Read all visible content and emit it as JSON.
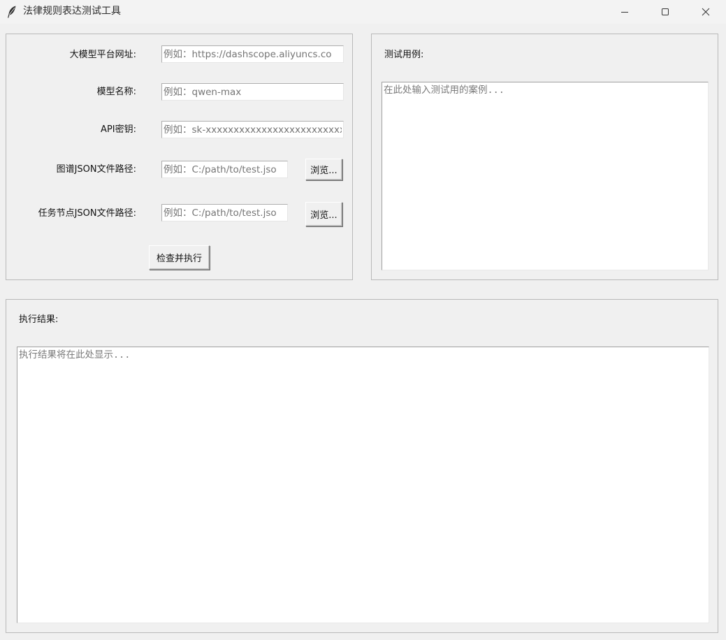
{
  "window": {
    "title": "法律规则表达测试工具",
    "icon": "feather-icon",
    "controls": {
      "minimize": "minimize-icon",
      "maximize": "maximize-icon",
      "close": "close-icon"
    }
  },
  "config": {
    "platform_url": {
      "label": "大模型平台网址:",
      "placeholder": "例如：https://dashscope.aliyuncs.co"
    },
    "model_name": {
      "label": "模型名称:",
      "placeholder": "例如：qwen-max"
    },
    "api_key": {
      "label": "API密钥:",
      "placeholder": "例如：sk-xxxxxxxxxxxxxxxxxxxxxxxxxxxx"
    },
    "graph_json": {
      "label": "图谱JSON文件路径:",
      "placeholder": "例如：C:/path/to/test.jso",
      "browse": "浏览..."
    },
    "task_json": {
      "label": "任务节点JSON文件路径:",
      "placeholder": "例如：C:/path/to/test.jso",
      "browse": "浏览..."
    },
    "run_button": "检查并执行"
  },
  "test_case": {
    "label": "测试用例:",
    "placeholder": "在此处输入测试用的案例..."
  },
  "result": {
    "label": "执行结果:",
    "placeholder": "执行结果将在此处显示..."
  },
  "colors": {
    "background": "#f0f0f0",
    "titlebar": "#f3f3f3",
    "input_bg": "#ffffff",
    "placeholder_text": "#8a8a8a"
  }
}
